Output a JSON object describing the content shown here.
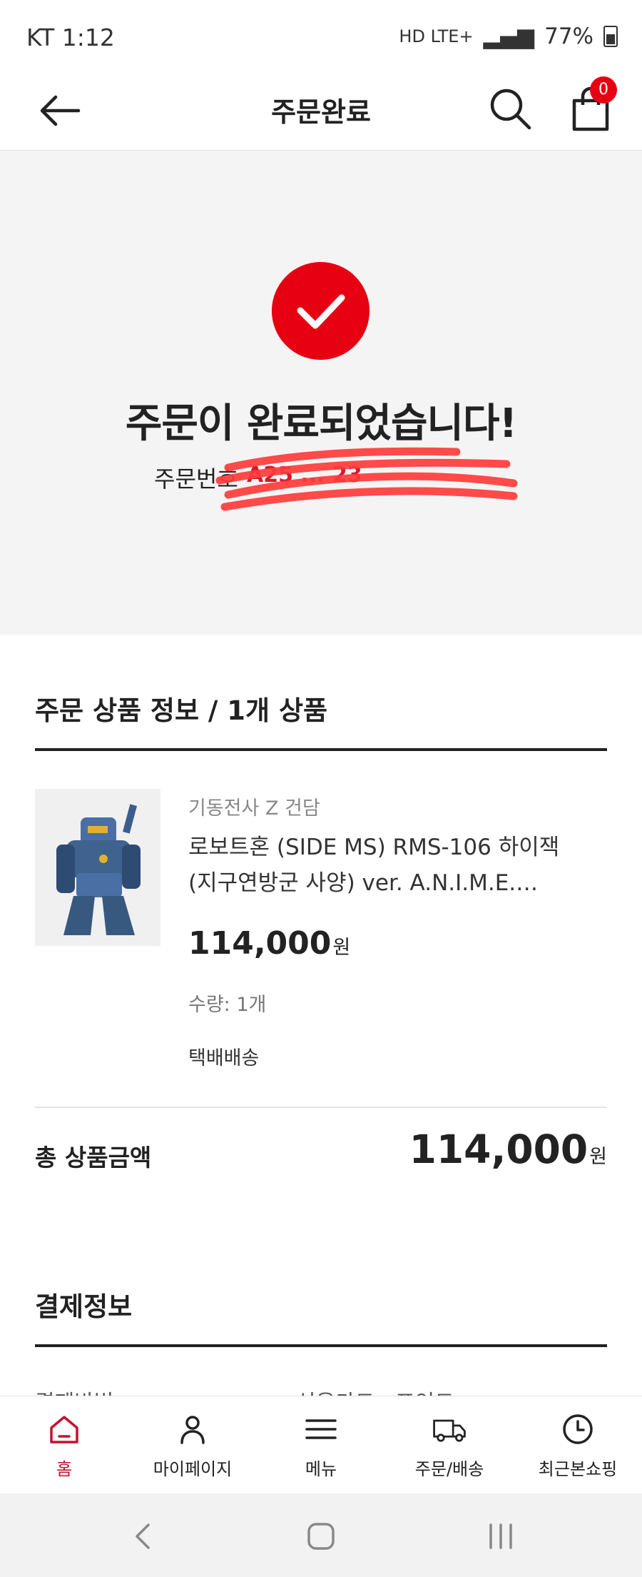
{
  "status_bar": {
    "carrier_time": "KT 1:12",
    "network": "HD LTE+",
    "battery": "77%"
  },
  "header": {
    "title": "주문완료",
    "cart_count": "0"
  },
  "completion": {
    "message": "주문이 완료되었습니다!",
    "order_label": "주문번호",
    "order_number_visible": "A25 ... 23"
  },
  "order_items": {
    "section_title": "주문 상품 정보 / 1개 상품",
    "item": {
      "brand": "기동전사 Z 건담",
      "name": "로보트혼 (SIDE MS) RMS-106 하이잭 (지구연방군 사양) ver. A.N.I.M.E.…",
      "price": "114,000",
      "price_unit": "원",
      "quantity": "수량: 1개",
      "shipping": "택배배송"
    },
    "total_label": "총 상품금액",
    "total_price": "114,000",
    "total_unit": "원"
  },
  "payment": {
    "section_title": "결제정보",
    "method_label": "결제방법",
    "method_value": "신용카드 · 포인트"
  },
  "bottom_nav": [
    {
      "label": "홈",
      "icon": "home-icon",
      "active": true
    },
    {
      "label": "마이페이지",
      "icon": "person-icon"
    },
    {
      "label": "메뉴",
      "icon": "menu-icon"
    },
    {
      "label": "주문/배송",
      "icon": "truck-icon"
    },
    {
      "label": "최근본쇼핑",
      "icon": "clock-icon"
    }
  ],
  "colors": {
    "accent": "#e60012",
    "active_nav": "#c8102e"
  }
}
